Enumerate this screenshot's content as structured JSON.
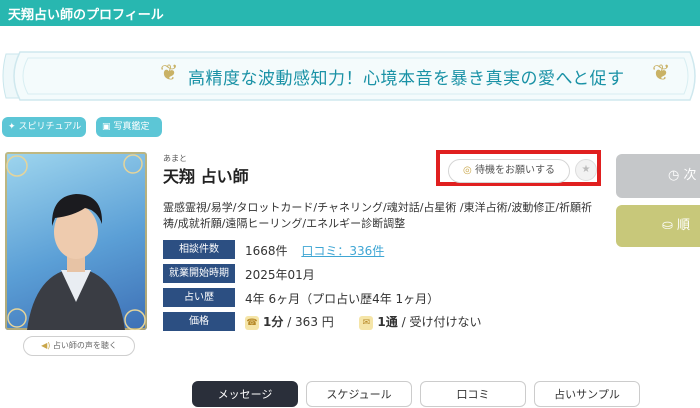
{
  "header": {
    "title": "天翔占い師のプロフィール"
  },
  "banner": {
    "text": "高精度な波動感知力！心境本音を暴き真実の愛へと促す",
    "left_ornament": "❦",
    "right_ornament": "❦"
  },
  "categories": [
    {
      "label": "スピリチュアル",
      "icon": "sparkle-icon",
      "glyph": "✦"
    },
    {
      "label": "写真鑑定",
      "icon": "photo-icon",
      "glyph": "▣"
    }
  ],
  "profile": {
    "ruby": "あまと",
    "name": "天翔 占い師",
    "voice_button": "占い師の声を聴く",
    "voice_glyph": "◀)",
    "wait_button": "待機をお願いする",
    "wait_glyph": "◎",
    "favorite_glyph": "★",
    "genres": "霊感霊視/易学/タロットカード/チャネリング/魂対話/占星術 /東洋占術/波動修正/祈願祈祷/成就祈願/遠隔ヒーリング/エネルギー診断調整"
  },
  "side_buttons": {
    "btn1_label": "次",
    "btn1_glyph": "◷",
    "btn2_label": "順",
    "btn2_glyph": "⛀"
  },
  "info": {
    "consult_label": "相談件数",
    "consult_value": "1668件",
    "review_link": "口コミ：336件",
    "start_label": "就業開始時期",
    "start_value": "2025年01月",
    "history_label": "占い歴",
    "history_value": "4年 6ヶ月（プロ占い歴4年 1ヶ月）",
    "price_label": "価格",
    "phone_glyph": "☎",
    "price_per_min": "1分",
    "price_value": "/ 363 円",
    "mail_glyph": "✉",
    "mail_per": "1通",
    "mail_value": "/  受け付けない"
  },
  "tabs": [
    {
      "label": "メッセージ",
      "active": true
    },
    {
      "label": "スケジュール",
      "active": false
    },
    {
      "label": "口コミ",
      "active": false
    },
    {
      "label": "占いサンプル",
      "active": false
    }
  ],
  "colors": {
    "header": "#28b7b0",
    "label_bg": "#2c4f82",
    "pill": "#5cc6d6",
    "highlight": "#e01f1f",
    "gold": "#c9b266"
  }
}
